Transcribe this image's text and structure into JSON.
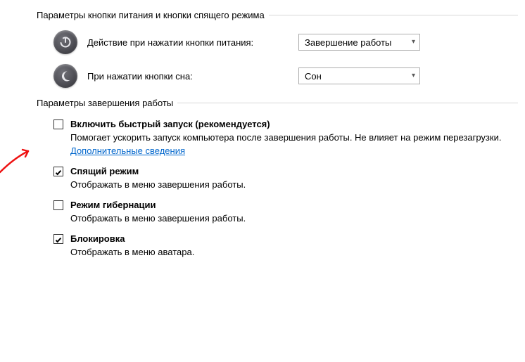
{
  "section1": {
    "title": "Параметры кнопки питания и кнопки спящего режима",
    "rows": [
      {
        "label": "Действие при нажатии кнопки питания:",
        "value": "Завершение работы"
      },
      {
        "label": "При нажатии кнопки сна:",
        "value": "Сон"
      }
    ]
  },
  "section2": {
    "title": "Параметры завершения работы",
    "options": [
      {
        "checked": false,
        "title": "Включить быстрый запуск (рекомендуется)",
        "desc_pre": "Помогает ускорить запуск компьютера после завершения работы. Не влияет на режим перезагрузки. ",
        "link": "Дополнительные сведения"
      },
      {
        "checked": true,
        "title": "Спящий режим",
        "desc_pre": "Отображать в меню завершения работы.",
        "link": ""
      },
      {
        "checked": false,
        "title": "Режим гибернации",
        "desc_pre": "Отображать в меню завершения работы.",
        "link": ""
      },
      {
        "checked": true,
        "title": "Блокировка",
        "desc_pre": "Отображать в меню аватара.",
        "link": ""
      }
    ]
  }
}
